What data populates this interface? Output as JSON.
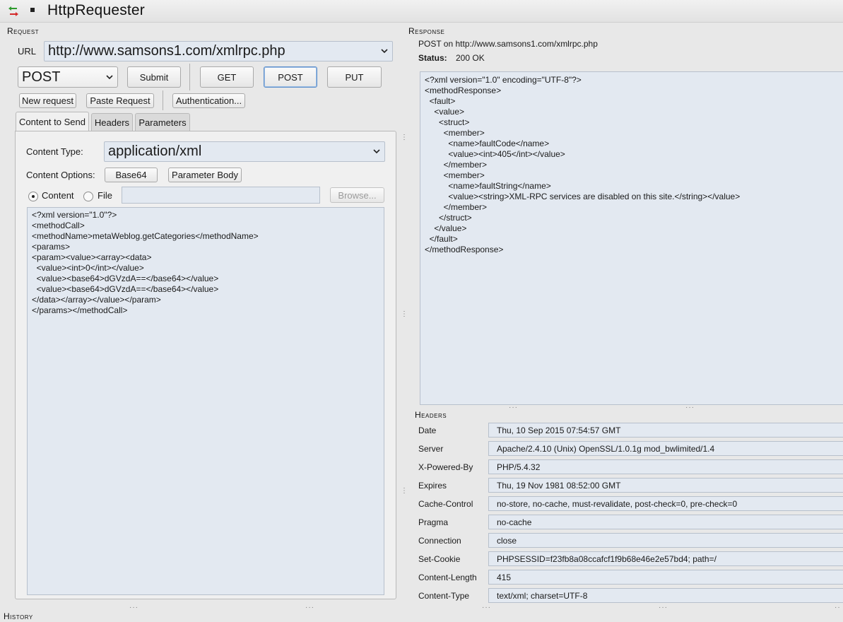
{
  "app": {
    "title": "HttpRequester"
  },
  "request": {
    "section_title": "Request",
    "url_label": "URL",
    "url_value": "http://www.samsons1.com/xmlrpc.php",
    "method_value": "POST",
    "buttons": {
      "submit": "Submit",
      "get": "GET",
      "post": "POST",
      "put": "PUT",
      "new_request": "New request",
      "paste_request": "Paste Request",
      "authentication": "Authentication..."
    },
    "tabs": [
      "Content to Send",
      "Headers",
      "Parameters"
    ],
    "content_type_label": "Content Type:",
    "content_type_value": "application/xml",
    "content_options_label": "Content Options:",
    "base64_button": "Base64",
    "parameter_body_button": "Parameter Body",
    "content_radio": "Content",
    "file_radio": "File",
    "file_path_value": "",
    "browse_button": "Browse...",
    "body": "<?xml version=\"1.0\"?>\n<methodCall>\n<methodName>metaWeblog.getCategories</methodName>\n<params>\n<param><value><array><data>\n  <value><int>0</int></value>\n  <value><base64>dGVzdA==</base64></value>\n  <value><base64>dGVzdA==</base64></value>\n</data></array></value></param>\n</params></methodCall>"
  },
  "response": {
    "section_title": "Response",
    "summary": "POST on http://www.samsons1.com/xmlrpc.php",
    "status_label": "Status:",
    "status_value": "200 OK",
    "body": "<?xml version=\"1.0\" encoding=\"UTF-8\"?>\n<methodResponse>\n  <fault>\n    <value>\n      <struct>\n        <member>\n          <name>faultCode</name>\n          <value><int>405</int></value>\n        </member>\n        <member>\n          <name>faultString</name>\n          <value><string>XML-RPC services are disabled on this site.</string></value>\n        </member>\n      </struct>\n    </value>\n  </fault>\n</methodResponse>",
    "headers_title": "Headers",
    "headers": [
      {
        "name": "Date",
        "value": "Thu, 10 Sep 2015 07:54:57 GMT"
      },
      {
        "name": "Server",
        "value": "Apache/2.4.10 (Unix) OpenSSL/1.0.1g mod_bwlimited/1.4"
      },
      {
        "name": "X-Powered-By",
        "value": "PHP/5.4.32"
      },
      {
        "name": "Expires",
        "value": "Thu, 19 Nov 1981 08:52:00 GMT"
      },
      {
        "name": "Cache-Control",
        "value": "no-store, no-cache, must-revalidate, post-check=0, pre-check=0"
      },
      {
        "name": "Pragma",
        "value": "no-cache"
      },
      {
        "name": "Connection",
        "value": "close"
      },
      {
        "name": "Set-Cookie",
        "value": "PHPSESSID=f23fb8a08ccafcf1f9b68e46e2e57bd4; path=/"
      },
      {
        "name": "Content-Length",
        "value": "415"
      },
      {
        "name": "Content-Type",
        "value": "text/xml; charset=UTF-8"
      }
    ]
  },
  "history": {
    "section_title": "History"
  }
}
